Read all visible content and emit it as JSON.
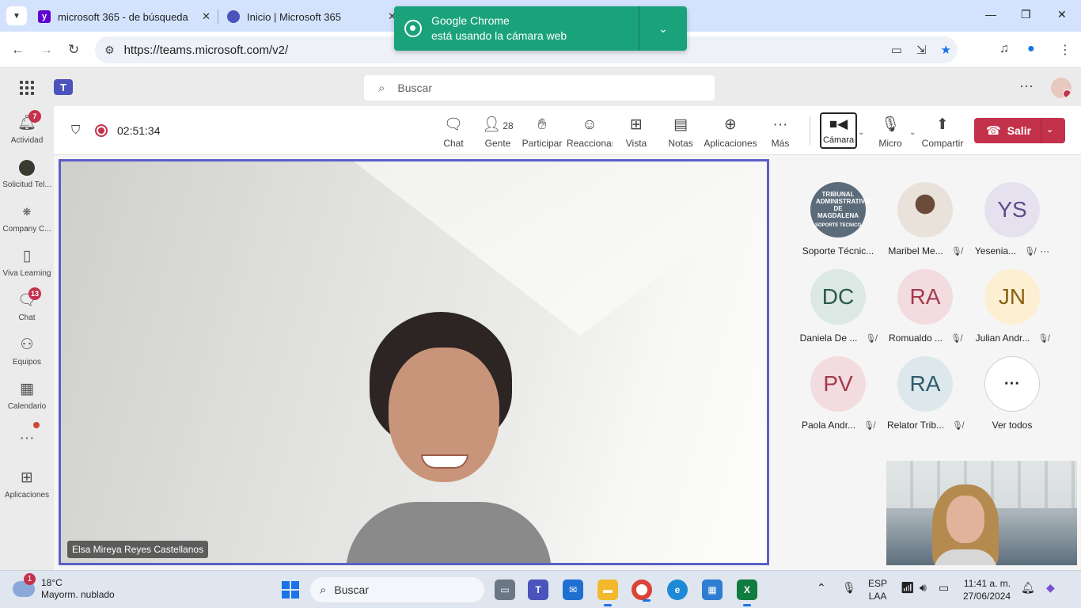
{
  "browser": {
    "tabs": [
      {
        "title": "microsoft 365 - de búsqueda",
        "icon": "yahoo-icon",
        "color": "#6001d2"
      },
      {
        "title": "Inicio | Microsoft 365",
        "icon": "m365-icon",
        "color": "#4b53bc"
      }
    ],
    "url": "https://teams.microsoft.com/v2/",
    "popup": {
      "line1": "Google Chrome",
      "line2": "está usando la cámara web"
    }
  },
  "teams": {
    "search_placeholder": "Buscar",
    "rail": [
      {
        "label": "Actividad",
        "badge": "7",
        "icon": "bell-icon"
      },
      {
        "label": "Solicitud Tel...",
        "icon": "app-logo-icon"
      },
      {
        "label": "Company C...",
        "icon": "company-icon"
      },
      {
        "label": "Viva Learning",
        "icon": "book-icon"
      },
      {
        "label": "Chat",
        "badge": "13",
        "icon": "chat-icon"
      },
      {
        "label": "Equipos",
        "icon": "teams-icon"
      },
      {
        "label": "Calendario",
        "icon": "calendar-icon"
      },
      {
        "label": "Aplicaciones",
        "icon": "add-apps-icon"
      }
    ],
    "meeting": {
      "timer": "02:51:34",
      "toolbar": [
        {
          "label": "Chat",
          "icon": "chat-icon"
        },
        {
          "label": "Gente",
          "count": "28",
          "icon": "people-icon"
        },
        {
          "label": "Participar",
          "icon": "raise-hand-icon"
        },
        {
          "label": "Reaccionar",
          "icon": "emoji-icon"
        },
        {
          "label": "Vista",
          "icon": "grid-view-icon"
        },
        {
          "label": "Notas",
          "icon": "notes-icon"
        },
        {
          "label": "Aplicaciones",
          "icon": "add-icon"
        },
        {
          "label": "Más",
          "icon": "more-icon"
        }
      ],
      "camera_label": "Cámara",
      "mic_label": "Micro",
      "share_label": "Compartir",
      "leave_label": "Salir",
      "main_speaker": "Elsa Mireya Reyes Castellanos",
      "participants": [
        {
          "name": "Soporte Técnic...",
          "initials": "",
          "bg": "#5b6b7a",
          "fg": "#fff",
          "muted": false,
          "photo": true,
          "photo_text": "TRIBUNAL ADMINISTRATIVO DE MAGDALENA",
          "photo_sub": "SOPORTE TECNICO"
        },
        {
          "name": "Maribel Me...",
          "initials": "",
          "bg": "#d7cbbf",
          "fg": "#fff",
          "muted": true,
          "photo": true
        },
        {
          "name": "Yesenia...",
          "initials": "YS",
          "bg": "#e6e1ef",
          "fg": "#5e4b8b",
          "muted": true,
          "more": true
        },
        {
          "name": "Daniela De ...",
          "initials": "DC",
          "bg": "#dbe8e3",
          "fg": "#2a5a4c",
          "muted": true
        },
        {
          "name": "Romualdo ...",
          "initials": "RA",
          "bg": "#f3dcdf",
          "fg": "#a33a4c",
          "muted": true
        },
        {
          "name": "Julian Andr...",
          "initials": "JN",
          "bg": "#fcefd2",
          "fg": "#8a6012",
          "muted": true
        },
        {
          "name": "Paola Andr...",
          "initials": "PV",
          "bg": "#f3dcdf",
          "fg": "#a33a4c",
          "muted": true
        },
        {
          "name": "Relator Trib...",
          "initials": "RA",
          "bg": "#dde8ec",
          "fg": "#2f5a6a",
          "muted": true
        },
        {
          "name": "Ver todos",
          "initials": "···",
          "bg": "#ffffff",
          "fg": "#242424",
          "muted": false
        }
      ]
    }
  },
  "taskbar": {
    "weather_temp": "18°C",
    "weather_desc": "Mayorm. nublado",
    "weather_badge": "1",
    "search_placeholder": "Buscar",
    "lang_line1": "ESP",
    "lang_line2": "LAA",
    "time": "11:41 a. m.",
    "date": "27/06/2024"
  }
}
